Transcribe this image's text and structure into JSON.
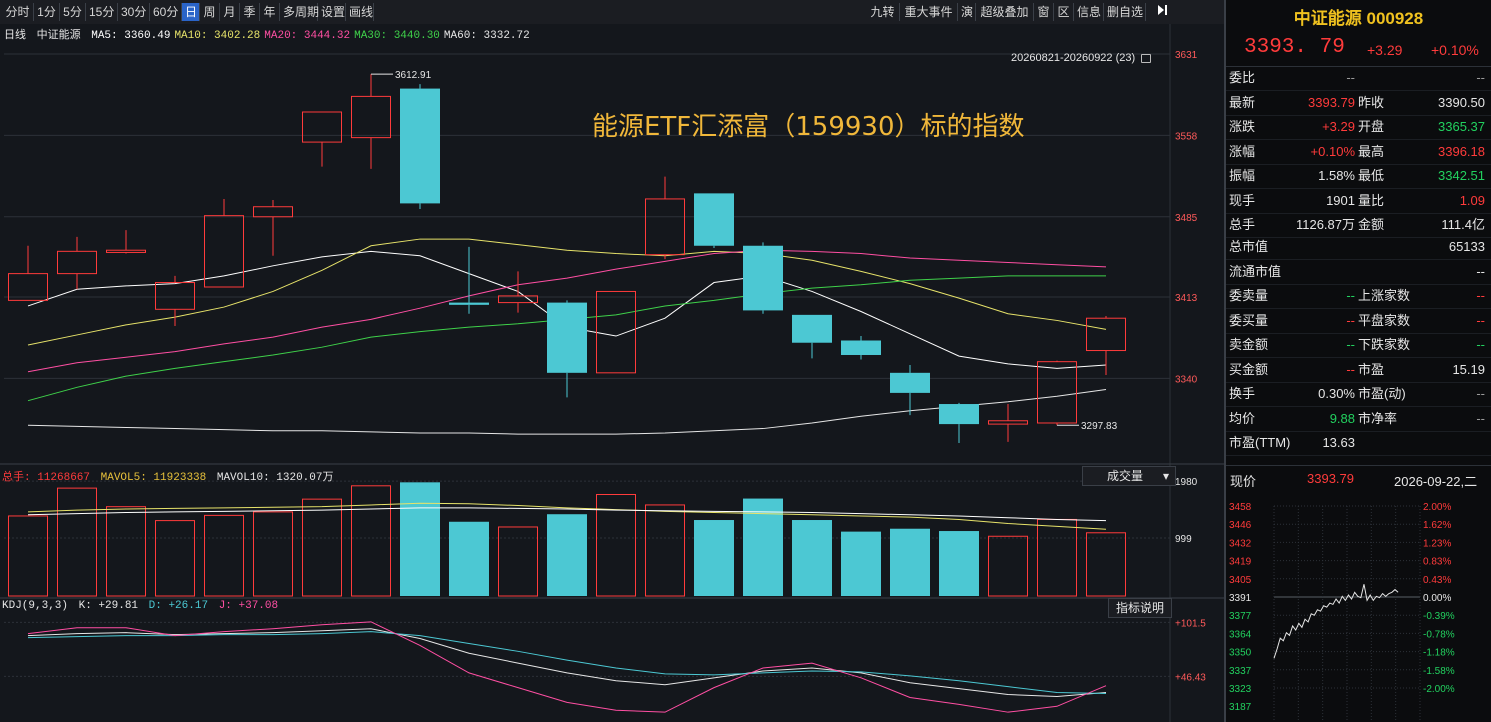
{
  "toolbar": {
    "periods": [
      "分时",
      "1分",
      "5分",
      "15分",
      "30分",
      "60分",
      "日",
      "周",
      "月",
      "季",
      "年",
      "多周期",
      "设置",
      "画线"
    ],
    "active_period": "日",
    "right_buttons": [
      "九转",
      "重大事件",
      "演",
      "超级叠加",
      "窗",
      "区",
      "信息",
      "删自选"
    ]
  },
  "ma_legend": {
    "period": "日线",
    "name": "中证能源",
    "items": [
      {
        "label": "MA5: 3360.49",
        "color": "#ffffff"
      },
      {
        "label": "MA10: 3402.28",
        "color": "#e7e36a"
      },
      {
        "label": "MA20: 3444.32",
        "color": "#ff4fa3"
      },
      {
        "label": "MA30: 3440.30",
        "color": "#3fd14a"
      },
      {
        "label": "MA60: 3332.72",
        "color": "#e6e6e6"
      }
    ]
  },
  "range_label": "20260821-20260922 (23)",
  "overlay_title": "能源ETF汇添富（159930）标的指数",
  "price_axis": [
    "3631",
    "3558",
    "3485",
    "3413",
    "3340"
  ],
  "high_label": "3612.91",
  "low_label": "3297.83",
  "candles": [
    {
      "o": 3410,
      "c": 3434,
      "h": 3459,
      "l": 3410
    },
    {
      "o": 3434,
      "c": 3454,
      "h": 3467,
      "l": 3420
    },
    {
      "o": 3453,
      "c": 3455,
      "h": 3473,
      "l": 3452
    },
    {
      "o": 3402,
      "c": 3426,
      "h": 3432,
      "l": 3387
    },
    {
      "o": 3422,
      "c": 3486,
      "h": 3501,
      "l": 3422
    },
    {
      "o": 3485,
      "c": 3494,
      "h": 3500,
      "l": 3450
    },
    {
      "o": 3552,
      "c": 3579,
      "h": 3579,
      "l": 3530
    },
    {
      "o": 3556,
      "c": 3593,
      "h": 3613,
      "l": 3528
    },
    {
      "o": 3600,
      "c": 3497,
      "h": 3604,
      "l": 3492
    },
    {
      "o": 3408,
      "c": 3406,
      "h": 3458,
      "l": 3398
    },
    {
      "o": 3408,
      "c": 3414,
      "h": 3436,
      "l": 3399
    },
    {
      "o": 3408,
      "c": 3345,
      "h": 3410,
      "l": 3323
    },
    {
      "o": 3345,
      "c": 3418,
      "h": 3418,
      "l": 3345
    },
    {
      "o": 3451,
      "c": 3501,
      "h": 3521,
      "l": 3447
    },
    {
      "o": 3506,
      "c": 3459,
      "h": 3506,
      "l": 3457
    },
    {
      "o": 3459,
      "c": 3401,
      "h": 3462,
      "l": 3398
    },
    {
      "o": 3397,
      "c": 3372,
      "h": 3397,
      "l": 3358
    },
    {
      "o": 3374,
      "c": 3361,
      "h": 3378,
      "l": 3357
    },
    {
      "o": 3345,
      "c": 3327,
      "h": 3352,
      "l": 3307
    },
    {
      "o": 3317,
      "c": 3299,
      "h": 3318,
      "l": 3282
    },
    {
      "o": 3299,
      "c": 3302,
      "h": 3317,
      "l": 3283
    },
    {
      "o": 3300,
      "c": 3355,
      "h": 3356,
      "l": 3298
    },
    {
      "o": 3365,
      "c": 3394,
      "h": 3396,
      "l": 3343
    }
  ],
  "ma_lines": {
    "ma5": [
      3405,
      3420,
      3423,
      3425,
      3432,
      3441,
      3449,
      3454,
      3450,
      3434,
      3418,
      3386,
      3378,
      3394,
      3426,
      3432,
      3418,
      3400,
      3380,
      3360,
      3353,
      3349,
      3352
    ],
    "ma10": [
      3370,
      3379,
      3388,
      3395,
      3404,
      3418,
      3437,
      3459,
      3465,
      3465,
      3460,
      3455,
      3452,
      3450,
      3454,
      3452,
      3446,
      3436,
      3425,
      3412,
      3398,
      3392,
      3384
    ],
    "ma20": [
      3346,
      3354,
      3359,
      3364,
      3371,
      3377,
      3386,
      3393,
      3403,
      3414,
      3424,
      3430,
      3438,
      3445,
      3452,
      3455,
      3454,
      3452,
      3448,
      3446,
      3444,
      3442,
      3440
    ],
    "ma30": [
      3320,
      3332,
      3342,
      3349,
      3355,
      3361,
      3368,
      3377,
      3382,
      3386,
      3389,
      3393,
      3397,
      3405,
      3410,
      3416,
      3421,
      3424,
      3428,
      3430,
      3432,
      3432,
      3432
    ],
    "ma60": [
      3298,
      3297,
      3296,
      3295,
      3294,
      3293,
      3293,
      3292,
      3291,
      3291,
      3290,
      3290,
      3290,
      3291,
      3293,
      3295,
      3300,
      3306,
      3311,
      3315,
      3319,
      3324,
      3330
    ]
  },
  "volume_legend": {
    "label": "总手: 11268667",
    "mavol5": "MAVOL5: 11923338",
    "mavol10": "MAVOL10: 1320.07万"
  },
  "volume_dropdown": "成交量",
  "volume_axis": [
    "1980",
    "999"
  ],
  "volumes": [
    1380,
    1860,
    1540,
    1300,
    1390,
    1450,
    1670,
    1900,
    1960,
    1280,
    1190,
    1410,
    1750,
    1570,
    1310,
    1680,
    1310,
    1110,
    1160,
    1120,
    1030,
    1320,
    1090
  ],
  "mavol5": [
    1450,
    1480,
    1500,
    1510,
    1520,
    1530,
    1540,
    1570,
    1600,
    1590,
    1560,
    1520,
    1490,
    1460,
    1440,
    1420,
    1400,
    1380,
    1360,
    1320,
    1250,
    1200,
    1150
  ],
  "mavol10": [
    1400,
    1420,
    1440,
    1450,
    1460,
    1470,
    1480,
    1500,
    1520,
    1520,
    1510,
    1500,
    1480,
    1470,
    1460,
    1450,
    1440,
    1420,
    1400,
    1380,
    1350,
    1320,
    1300
  ],
  "kdj_legend": {
    "label": "KDJ(9,3,3)",
    "k": "K: +29.81",
    "d": "D: +26.17",
    "j": "J: +37.08"
  },
  "kdj_button": "指标说明",
  "kdj_axis": [
    "+101.5",
    "+46.43"
  ],
  "kdj": {
    "k": [
      88,
      90,
      91,
      89,
      90,
      91,
      93,
      95,
      85,
      70,
      60,
      50,
      42,
      38,
      45,
      52,
      55,
      50,
      40,
      34,
      28,
      26,
      30
    ],
    "d": [
      86,
      87,
      88,
      88,
      89,
      89,
      90,
      92,
      88,
      80,
      72,
      63,
      55,
      49,
      48,
      50,
      52,
      51,
      47,
      42,
      36,
      30,
      29
    ],
    "j": [
      90,
      96,
      96,
      88,
      92,
      95,
      99,
      102,
      78,
      50,
      35,
      20,
      12,
      10,
      35,
      55,
      60,
      45,
      25,
      18,
      10,
      16,
      37
    ]
  },
  "quote": {
    "title": "中证能源 000928",
    "price": "3393. 79",
    "change": "+3.29",
    "change_pct": "+0.10%",
    "rows_a": [
      {
        "l": "委比",
        "v": "--",
        "l2": "",
        "v2": "--",
        "c": "gray",
        "c2": "gray"
      },
      {
        "l": "最新",
        "v": "3393.79",
        "l2": "昨收",
        "v2": "3390.50",
        "c": "red",
        "c2": "white"
      },
      {
        "l": "涨跌",
        "v": "+3.29",
        "l2": "开盘",
        "v2": "3365.37",
        "c": "red",
        "c2": "green"
      },
      {
        "l": "涨幅",
        "v": "+0.10%",
        "l2": "最高",
        "v2": "3396.18",
        "c": "red",
        "c2": "red"
      },
      {
        "l": "振幅",
        "v": "1.58%",
        "l2": "最低",
        "v2": "3342.51",
        "c": "white",
        "c2": "green"
      },
      {
        "l": "现手",
        "v": "1901",
        "l2": "量比",
        "v2": "1.09",
        "c": "white",
        "c2": "red"
      },
      {
        "l": "总手",
        "v": "1126.87万",
        "l2": "金额",
        "v2": "111.4亿",
        "c": "white",
        "c2": "white"
      }
    ],
    "cap_rows": [
      {
        "l": "总市值",
        "v": "65133"
      },
      {
        "l": "流通市值",
        "v": "--"
      }
    ],
    "rows_b": [
      {
        "l": "委卖量",
        "v": "--",
        "l2": "上涨家数",
        "v2": "--",
        "c": "green",
        "c2": "red"
      },
      {
        "l": "委买量",
        "v": "--",
        "l2": "平盘家数",
        "v2": "--",
        "c": "red",
        "c2": "red"
      },
      {
        "l": "卖金额",
        "v": "--",
        "l2": "下跌家数",
        "v2": "--",
        "c": "green",
        "c2": "green"
      },
      {
        "l": "买金额",
        "v": "--",
        "l2": "市盈",
        "v2": "15.19",
        "c": "red",
        "c2": "white"
      },
      {
        "l": "换手",
        "v": "0.30%",
        "l2": "市盈(动)",
        "v2": "--",
        "c": "white",
        "c2": "gray"
      },
      {
        "l": "均价",
        "v": "9.88",
        "l2": "市净率",
        "v2": "--",
        "c": "green",
        "c2": "gray"
      },
      {
        "l": "市盈(TTM)",
        "v": "13.63",
        "l2": "",
        "v2": "",
        "c": "white",
        "c2": "white"
      }
    ],
    "now_label": "现价",
    "now_value": "3393.79",
    "date": "2026-09-22,二"
  },
  "mini_chart": {
    "left_axis": [
      "3458",
      "3446",
      "3432",
      "3419",
      "3405",
      "3391",
      "3377",
      "3364",
      "3350",
      "3337",
      "3323",
      "3187"
    ],
    "right_axis": [
      "2.00%",
      "1.62%",
      "1.23%",
      "0.83%",
      "0.43%",
      "0.00%",
      "-0.39%",
      "-0.78%",
      "-1.18%",
      "-1.58%",
      "-2.00%"
    ],
    "prices": [
      3345,
      3352,
      3360,
      3358,
      3364,
      3362,
      3369,
      3366,
      3371,
      3368,
      3374,
      3372,
      3378,
      3377,
      3381,
      3380,
      3384,
      3383,
      3386,
      3385,
      3389,
      3386,
      3391,
      3388,
      3392,
      3389,
      3394,
      3391,
      3390,
      3400,
      3388,
      3392,
      3388,
      3391,
      3390,
      3393,
      3391,
      3393,
      3394,
      3396,
      3394
    ]
  },
  "colors": {
    "up": "#ff3b3b",
    "down": "#4cc8d3",
    "grid": "#2c3138",
    "axis_text": "#ff5a5a"
  }
}
